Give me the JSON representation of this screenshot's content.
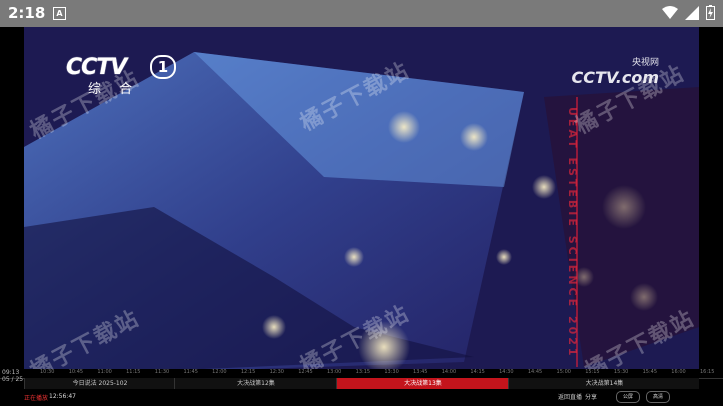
{
  "status_bar": {
    "time": "2:18",
    "notification_letter": "A",
    "icons": [
      "wifi-icon",
      "signal-icon",
      "battery-charging-icon"
    ]
  },
  "video": {
    "channel_logo_text": "CCTV",
    "channel_number": "1",
    "channel_subtitle": "综 合",
    "corner_logo_top": "央视网",
    "corner_logo_bottom": "CCTV.com",
    "watermark": "橘子下载站",
    "red_vertical_text": "UEAT ESTEBIE SCIENCE 2021"
  },
  "timeline": {
    "date_time": "09:13",
    "date": "05 / 25",
    "ticks": [
      "10:30",
      "10:45",
      "11:00",
      "11:15",
      "11:30",
      "11:45",
      "12:00",
      "12:15",
      "12:30",
      "12:45",
      "13:00",
      "13:15",
      "13:30",
      "13:45",
      "14:00",
      "14:15",
      "14:30",
      "14:45",
      "15:00",
      "15:15",
      "15:30",
      "15:45",
      "16:00",
      "16:15"
    ],
    "programs": [
      {
        "label": "今日说法 2025-102",
        "active": false
      },
      {
        "label": "大决战第12集",
        "active": false
      },
      {
        "label": "大决战第13集",
        "active": true
      },
      {
        "label": "大决战第14集",
        "active": false
      }
    ],
    "now_label": "正在播放",
    "now_time": "12:56:47",
    "back_live_label": "返回直播",
    "share_label": "分享",
    "pill_1": "公屏",
    "pill_2": "高清"
  }
}
